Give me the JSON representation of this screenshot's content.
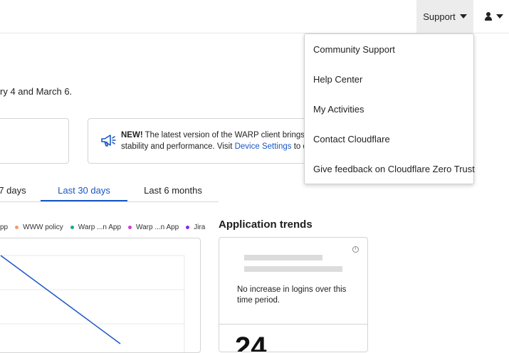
{
  "header": {
    "support_label": "Support"
  },
  "support_menu": {
    "items": [
      {
        "label": "Community Support"
      },
      {
        "label": "Help Center"
      },
      {
        "label": "My Activities"
      },
      {
        "label": "Contact Cloudflare"
      },
      {
        "label": "Give feedback on Cloudflare Zero Trust"
      }
    ]
  },
  "page": {
    "subtitle_fragment": "ry 4 and March 6."
  },
  "announcement": {
    "badge": "NEW!",
    "line1": " The latest version of the WARP client brings yo",
    "line2_prefix": "stability and performance. Visit ",
    "link_text": "Device Settings",
    "line2_suffix": " to do"
  },
  "time_tabs": {
    "items": [
      {
        "label": "7 days"
      },
      {
        "label": "Last 30 days",
        "active": true
      },
      {
        "label": "Last 6 months"
      }
    ]
  },
  "legend": {
    "items": [
      {
        "label": "pp",
        "color": "#f5a623"
      },
      {
        "label": "WWW policy",
        "color": "#f49a6c"
      },
      {
        "label": "Warp ...n App",
        "color": "#1aa88a"
      },
      {
        "label": "Warp ...n App",
        "color": "#d13bd8"
      },
      {
        "label": "Jira",
        "color": "#8a2be2"
      }
    ]
  },
  "app_trends": {
    "title": "Application trends",
    "message": "No increase in logins over this time period.",
    "count": "24"
  },
  "colors": {
    "accent": "#1a56c4",
    "chart_line": "#1a56c4"
  },
  "icons": {
    "support_caret": "chevron-down-icon",
    "user": "user-icon",
    "announcement": "megaphone-icon",
    "info": "info-icon"
  }
}
